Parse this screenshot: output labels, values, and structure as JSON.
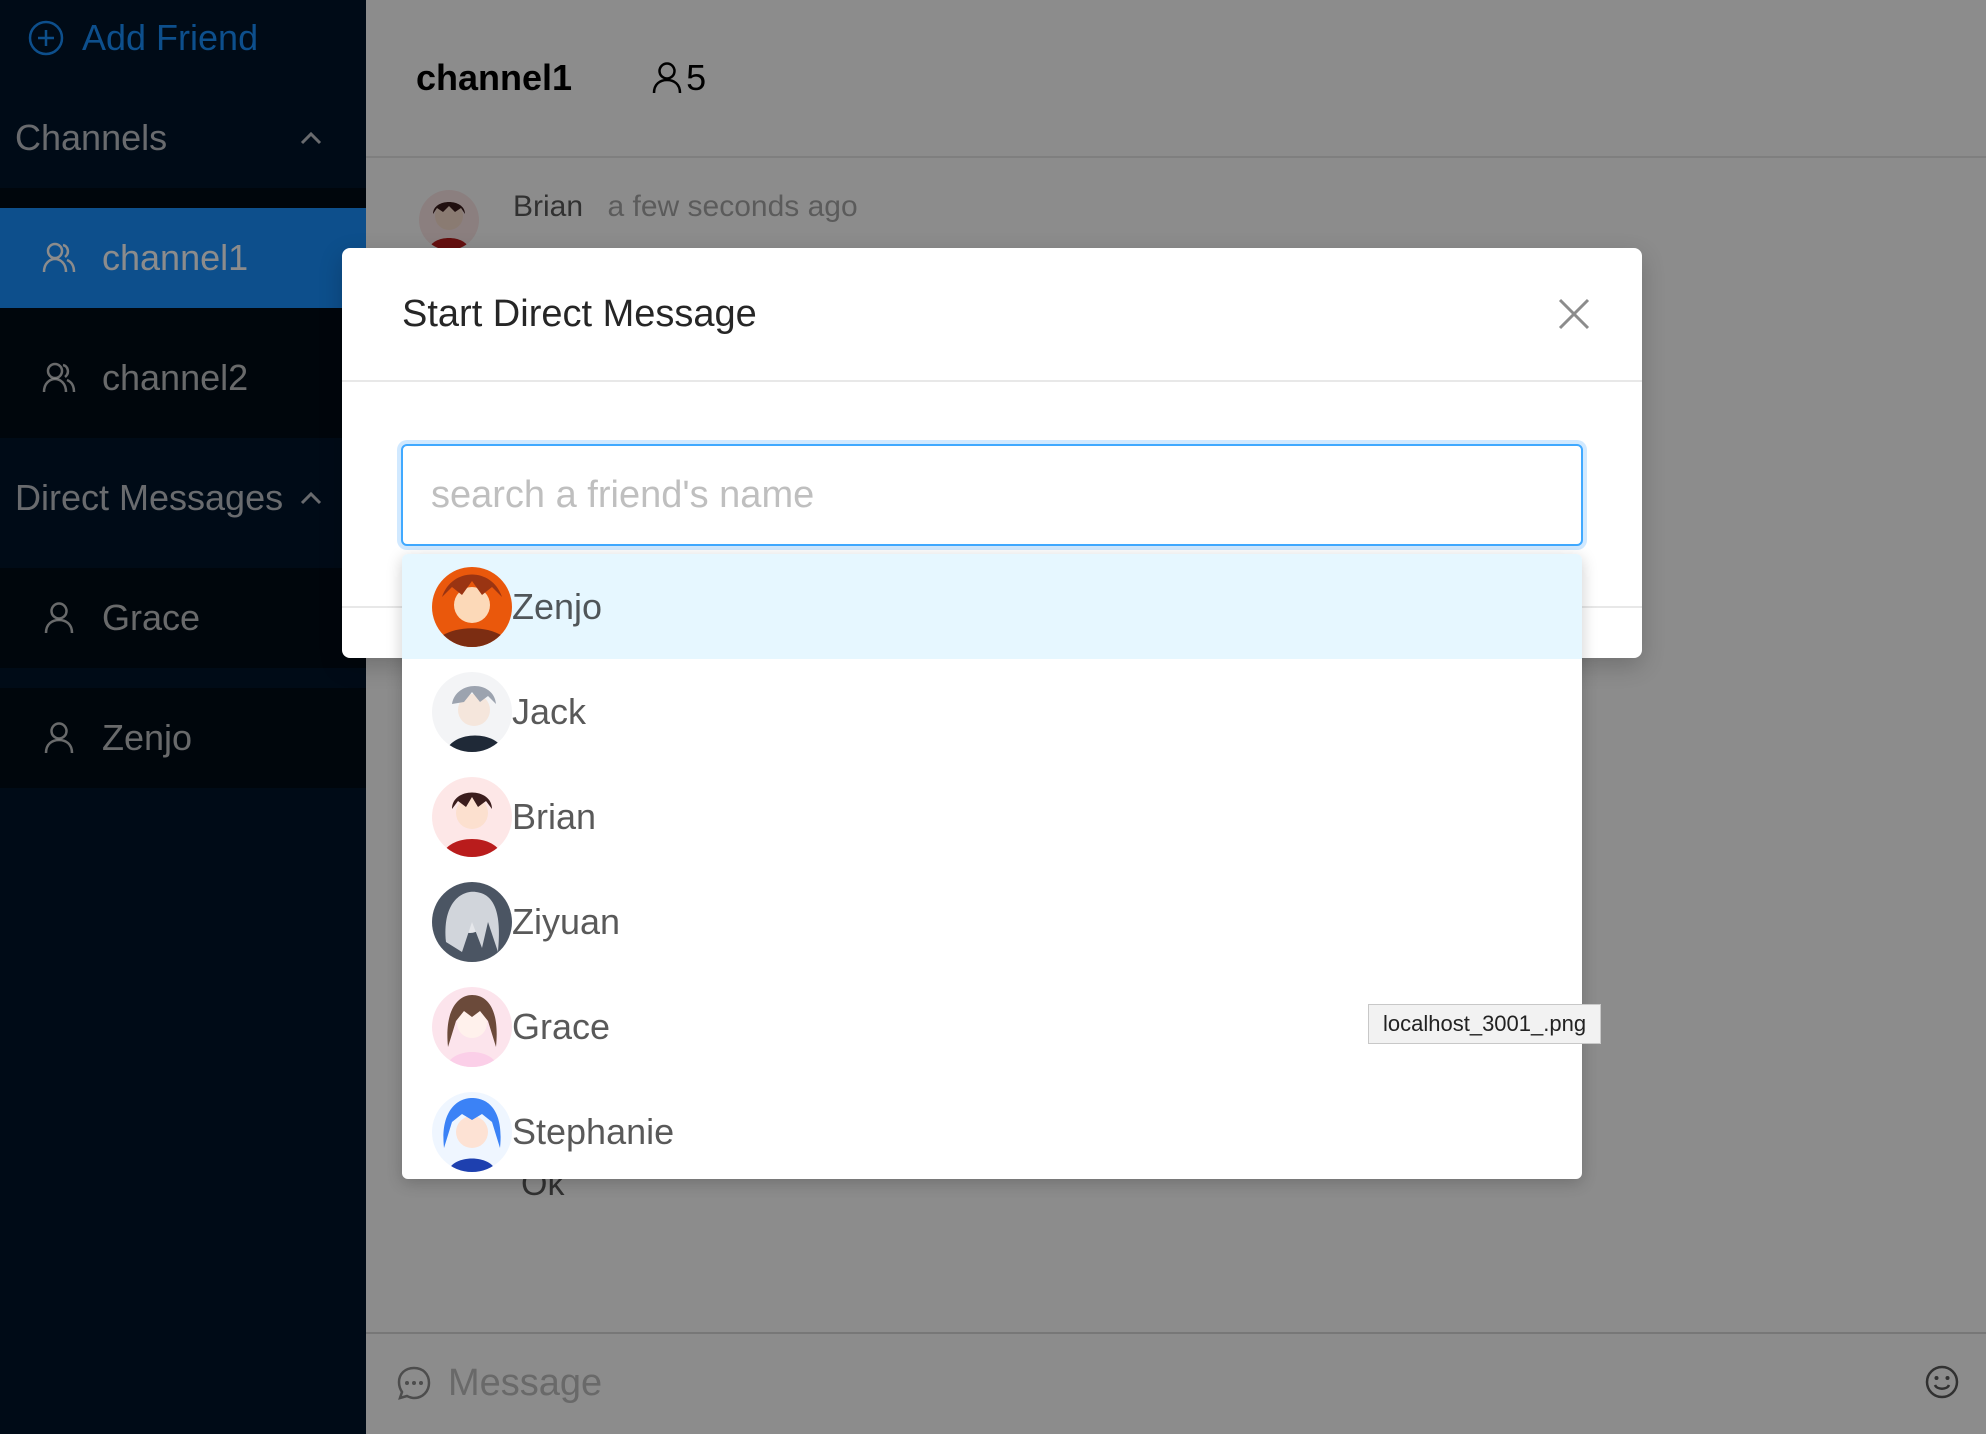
{
  "sidebar": {
    "add_friend": "Add Friend",
    "channels_label": "Channels",
    "channels": [
      {
        "label": "channel1"
      },
      {
        "label": "channel2"
      }
    ],
    "dm_label": "Direct Messages",
    "dms": [
      {
        "label": "Grace"
      },
      {
        "label": "Zenjo"
      }
    ]
  },
  "chat": {
    "channel_title": "channel1",
    "member_count": "5",
    "message": {
      "author": "Brian",
      "time": "a few seconds ago"
    },
    "last_message": "Ok",
    "input_placeholder": "Message"
  },
  "modal": {
    "title": "Start Direct Message",
    "search_placeholder": "search a friend's name",
    "friends": [
      {
        "name": "Zenjo",
        "color": "#c2410c"
      },
      {
        "name": "Jack",
        "color": "#9ca3af"
      },
      {
        "name": "Brian",
        "color": "#7f1d1d"
      },
      {
        "name": "Ziyuan",
        "color": "#6b7280"
      },
      {
        "name": "Grace",
        "color": "#f4c7c3"
      },
      {
        "name": "Stephanie",
        "color": "#3b82f6"
      }
    ]
  },
  "tooltip": "localhost_3001_.png",
  "colors": {
    "accent": "#1890ff",
    "sidebar": "#00142a",
    "active_option": "#e6f7ff"
  }
}
